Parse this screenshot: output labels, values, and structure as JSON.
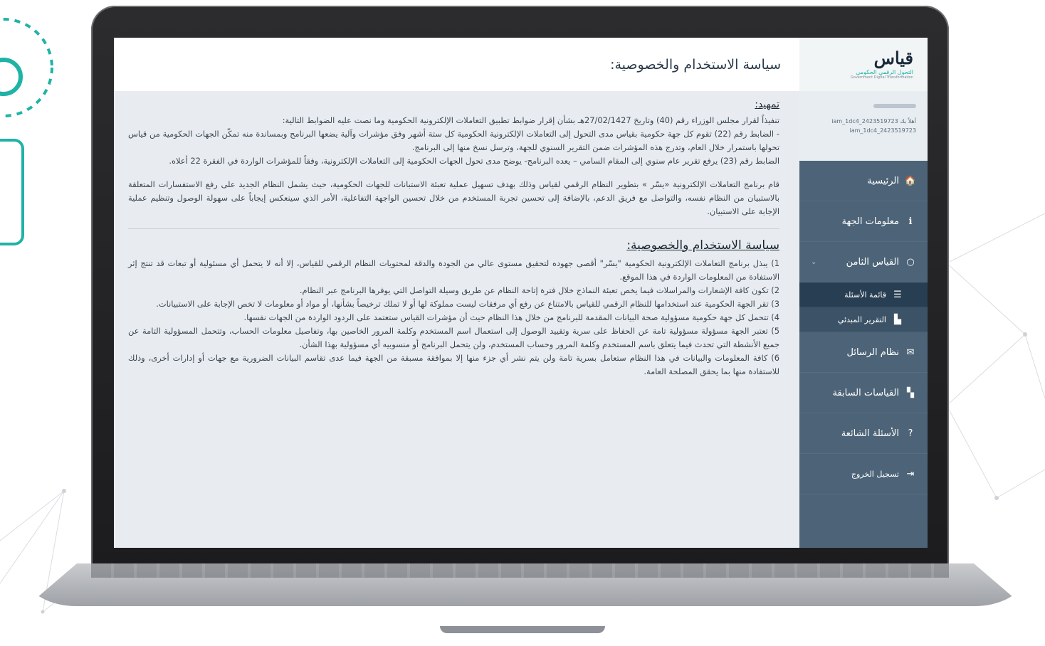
{
  "app": {
    "title": "سياسة الاستخدام والخصوصية:",
    "logo": {
      "name": "قياس",
      "subtitle": "التحول الرقمي الحكومي",
      "subtitle_en": "Government Digital Transformation"
    }
  },
  "user": {
    "greeting": "أهلاً بك iam_1dc4_2423519723",
    "username": "iam_1dc4_2423519723"
  },
  "sidebar": {
    "items": [
      {
        "label": "الرئيسية",
        "icon": "home-icon",
        "glyph": "🏠"
      },
      {
        "label": "معلومات الجهة",
        "icon": "info-icon",
        "glyph": "ℹ"
      },
      {
        "label": "القياس الثامن",
        "icon": "circle-icon",
        "glyph": "○"
      },
      {
        "label": "قائمة الأسئلة",
        "icon": "list-icon",
        "glyph": "☰"
      },
      {
        "label": "التقرير المبدئي",
        "icon": "chart-icon",
        "glyph": "▙"
      },
      {
        "label": "نظام الرسائل",
        "icon": "envelope-icon",
        "glyph": "✉"
      },
      {
        "label": "القياسات السابقة",
        "icon": "area-chart-icon",
        "glyph": "▚"
      },
      {
        "label": "الأسئلة الشائعة",
        "icon": "question-icon",
        "glyph": "?"
      },
      {
        "label": "تسجيل الخروج",
        "icon": "logout-icon",
        "glyph": "⇥"
      }
    ]
  },
  "content": {
    "intro_title": "تمهيد:",
    "intro_paragraphs": [
      "تنفيذاً لقرار مجلس الوزراء رقم (40) وتاريخ 27/02/1427هـ بشأن إقرار ضوابط تطبيق التعاملات الإلكترونية الحكومية وما نصت عليه الضوابط التالية:",
      "- الضابط رقم (22) تقوم كل جهة حكومية بقياس مدى التحول إلى التعاملات الإلكترونية الحكومية كل ستة أشهر وفق مؤشرات وآلية يضعها البرنامج وبمساندة منه تمكّن الجهات الحكومية من قياس تحولها باستمرار خلال العام، وتدرج هذه المؤشرات ضمن التقرير السنوي للجهة، وترسل نسخ منها إلى البرنامج.",
      "الضابط رقم (23) يرفع تقرير عام سنوي إلى المقام السامي – يعده البرنامج- يوضح مدى تحول الجهات الحكومية إلى التعاملات الإلكترونية، وفقاً للمؤشرات الواردة في الفقرة 22 أعلاه."
    ],
    "program_paragraph": "قام برنامج التعاملات الإلكترونية «يسّر » بتطوير النظام الرقمي لقياس وذلك بهدف تسهيل عملية تعبئة الاستبانات للجهات الحكومية، حيث يشمل النظام الجديد على رفع الاستفسارات المتعلقة بالاستبيان من النظام نفسه، والتواصل مع فريق الدعم، بالإضافة إلى تحسين تجربة المستخدم من خلال تحسين الواجهة التفاعلية، الأمر الذي سينعكس إيجاباً على سهولة الوصول وتنظيم عملية الإجابة على الاستبيان.",
    "policy_title": "سياسة الاستخدام والخصوصية:",
    "policy_items": [
      "1) يبذل برنامج التعاملات الإلكترونية الحكومية \"يسّر\" أقصى جهوده لتحقيق مستوى عالي من الجودة والدقة لمحتويات النظام الرقمي للقياس، إلا أنه لا يتحمل أي مسئولية أو تبعات قد تنتج إثر الاستفادة من المعلومات الواردة في هذا الموقع.",
      "2) تكون كافة الإشعارات والمراسلات فيما يخص تعبئة النماذج خلال فترة إتاحة النظام عن طريق وسيلة التواصل التي يوفرها البرنامج عبر النظام.",
      "3) تقر الجهة الحكومية عند استخدامها للنظام الرقمي للقياس بالامتناع عن رفع أي مرفقات ليست مملوكة لها أو لا تملك ترخيصاً بشأنها، أو مواد أو معلومات لا تخص الإجابة على الاستبيانات.",
      "4) تتحمل كل جهة حكومية مسؤولية صحة البيانات المقدمة للبرنامج من خلال هذا النظام حيث أن مؤشرات القياس ستعتمد على الردود الواردة من الجهات نفسها.",
      "5) تعتبر الجهة مسؤولة مسؤولية تامة عن الحفاظ على سرية وتقييد الوصول إلى استعمال اسم المستخدم وكلمة المرور الخاصين بها، وتفاصيل معلومات الحساب، وتتحمل المسؤولية التامة عن جميع الأنشطة التي تحدث فيما يتعلق باسم المستخدم وكلمة المرور وحساب المستخدم، ولن يتحمل البرنامج أو منسوبيه أي مسؤولية بهذا الشأن.",
      "6) كافة المعلومات والبيانات في هذا النظام ستعامل بسرية تامة ولن يتم نشر أي جزء منها إلا بموافقة مسبقة من الجهة فيما عدى تقاسم البيانات الضرورية مع جهات أو إدارات أخرى، وذلك للاستفادة منها بما يحقق المصلحة العامة."
    ]
  },
  "colors": {
    "sidebar": "#4d6478",
    "sidebar_active": "#283e52",
    "accent": "#1fb3a6",
    "content_bg": "#e8ecf0"
  }
}
